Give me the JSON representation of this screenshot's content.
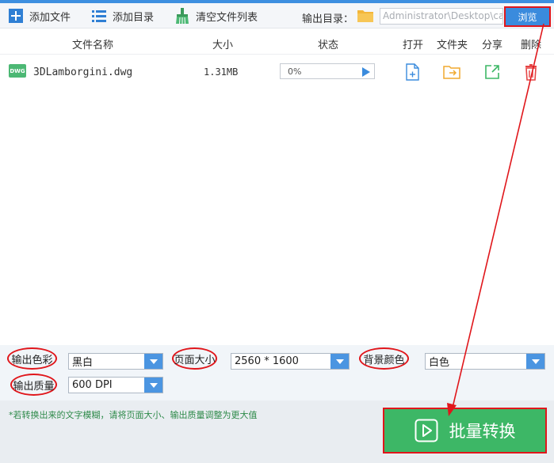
{
  "toolbar": {
    "add_file": "添加文件",
    "add_dir": "添加目录",
    "clear_list": "清空文件列表",
    "output_dir_label": "输出目录：",
    "output_path": "Administrator\\Desktop\\cad",
    "browse": "浏览"
  },
  "columns": {
    "name": "文件名称",
    "size": "大小",
    "status": "状态",
    "open": "打开",
    "folder": "文件夹",
    "share": "分享",
    "delete": "删除"
  },
  "files": [
    {
      "badge": "DWG",
      "name": "3DLamborgini.dwg",
      "size": "1.31MB",
      "progress_text": "0%",
      "progress": 0
    }
  ],
  "settings": {
    "color_label": "输出色彩",
    "color_value": "黑白",
    "page_size_label": "页面大小",
    "page_size_value": "2560 * 1600",
    "bg_label": "背景颜色",
    "bg_value": "白色",
    "quality_label": "输出质量",
    "quality_value": "600 DPI"
  },
  "footer": {
    "tip": "*若转换出来的文字模糊，请将页面大小、输出质量调整为更大值",
    "convert": "批量转换"
  },
  "colors": {
    "accent_blue": "#3a8bdd",
    "convert_green": "#3db766",
    "annotation_red": "#e0161b",
    "tip_green": "#2e8a4a"
  }
}
